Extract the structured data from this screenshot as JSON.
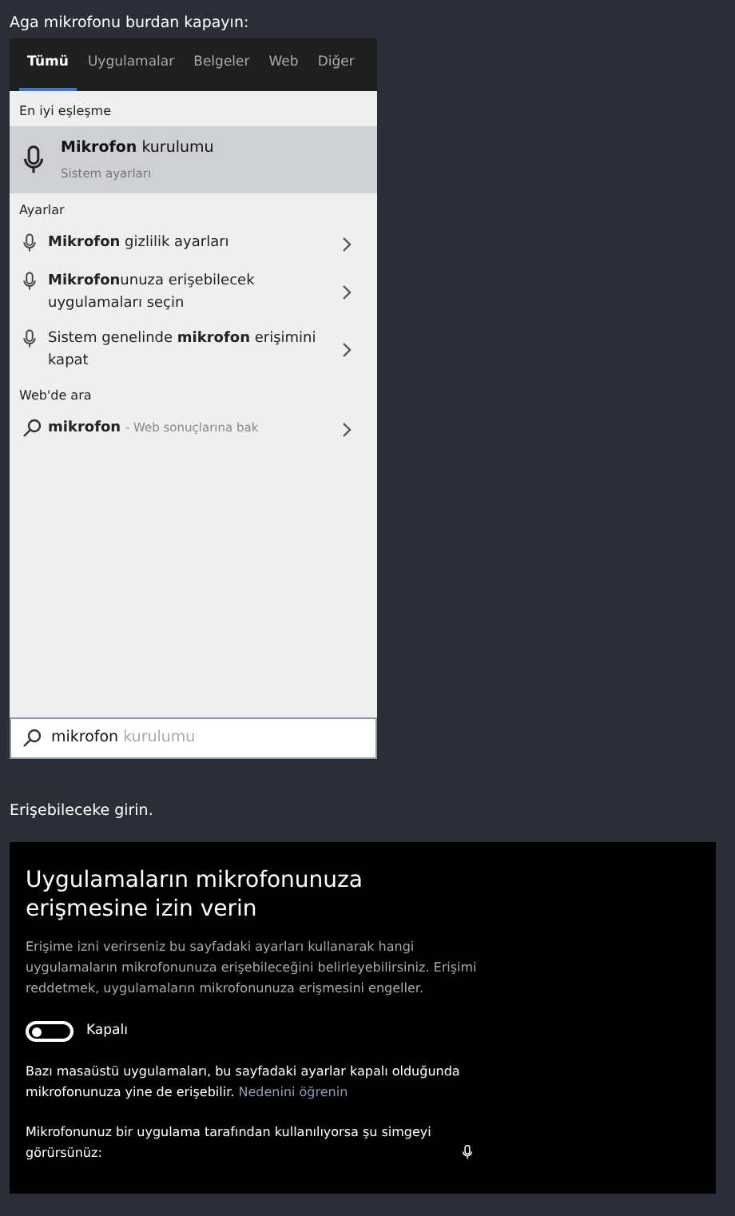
{
  "instruction_top": "Aga mikrofonu burdan kapayın:",
  "search_panel": {
    "tabs": [
      {
        "label": "Tümü",
        "selected": true
      },
      {
        "label": "Uygulamalar",
        "selected": false
      },
      {
        "label": "Belgeler",
        "selected": false
      },
      {
        "label": "Web",
        "selected": false
      },
      {
        "label": "Diğer",
        "selected": false
      }
    ],
    "best_match": {
      "heading": "En iyi eşleşme",
      "title": "**Mikrofon** kurulumu",
      "subtitle": "Sistem ayarları",
      "selected": true
    },
    "sections": [
      {
        "heading": "Ayarlar",
        "items": [
          {
            "kind": "setting",
            "text": "**Mikrofon** gizlilik ayarları"
          },
          {
            "kind": "setting",
            "text": "**Mikrofon**unuza erişebilecek uygulamaları seçin"
          },
          {
            "kind": "setting",
            "text": "Sistem genelinde **mikrofon** erişimini kapat"
          }
        ]
      },
      {
        "heading": "Web'de ara",
        "items": [
          {
            "kind": "web",
            "text": "**mikrofon**",
            "hint": "- Web sonuçlarına bak"
          }
        ]
      }
    ],
    "search_box": {
      "value": "mikrofon",
      "suggestion": "kurulumu"
    }
  },
  "instruction_mid": "Erişebileceke girin.",
  "settings_panel": {
    "title": "Uygulamaların mikrofonunuza erişmesine izin verin",
    "description": "Erişime izni verirseniz bu sayfadaki ayarları kullanarak hangi uygulamaların mikrofonunuza erişebileceğini belirleyebilirsiniz. Erişimi reddetmek, uygulamaların mikrofonunuza erişmesini engeller.",
    "toggle": {
      "on": false,
      "label": "Kapalı"
    },
    "note": {
      "text": "Bazı masaüstü uygulamaları, bu sayfadaki ayarlar kapalı olduğunda mikrofonunuza yine de erişebilir.",
      "link": "Nedenini öğrenin"
    },
    "icon_note": "Mikrofonunuz bir uygulama tarafından kullanılıyorsa şu simgeyi görürsünüz:"
  }
}
